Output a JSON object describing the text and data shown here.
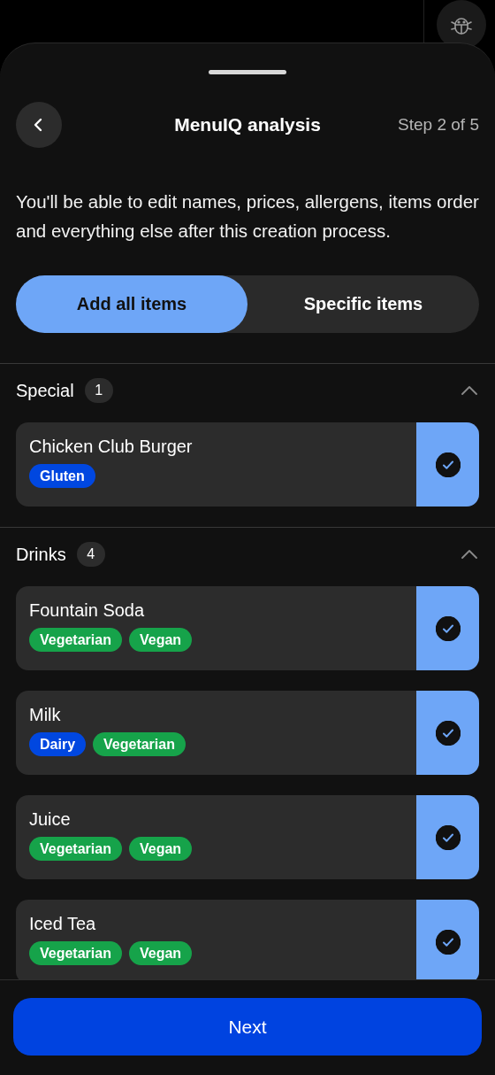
{
  "header": {
    "title": "MenuIQ analysis",
    "step": "Step 2 of 5"
  },
  "description": "You'll be able to edit names, prices, allergens, items order and everything else after this creation process.",
  "segments": [
    {
      "label": "Add all items",
      "selected": true
    },
    {
      "label": "Specific items",
      "selected": false
    }
  ],
  "sections": [
    {
      "name": "Special",
      "count": "1",
      "expanded": true,
      "items": [
        {
          "name": "Chicken Club Burger",
          "checked": true,
          "tags": [
            {
              "label": "Gluten",
              "color": "#0047e0"
            }
          ]
        }
      ]
    },
    {
      "name": "Drinks",
      "count": "4",
      "expanded": true,
      "items": [
        {
          "name": "Fountain Soda",
          "checked": true,
          "tags": [
            {
              "label": "Vegetarian",
              "color": "#16a34a"
            },
            {
              "label": "Vegan",
              "color": "#16a34a"
            }
          ]
        },
        {
          "name": "Milk",
          "checked": true,
          "tags": [
            {
              "label": "Dairy",
              "color": "#0047e0"
            },
            {
              "label": "Vegetarian",
              "color": "#16a34a"
            }
          ]
        },
        {
          "name": "Juice",
          "checked": true,
          "tags": [
            {
              "label": "Vegetarian",
              "color": "#16a34a"
            },
            {
              "label": "Vegan",
              "color": "#16a34a"
            }
          ]
        },
        {
          "name": "Iced Tea",
          "checked": true,
          "tags": [
            {
              "label": "Vegetarian",
              "color": "#16a34a"
            },
            {
              "label": "Vegan",
              "color": "#16a34a"
            }
          ]
        }
      ]
    }
  ],
  "next_button": "Next"
}
